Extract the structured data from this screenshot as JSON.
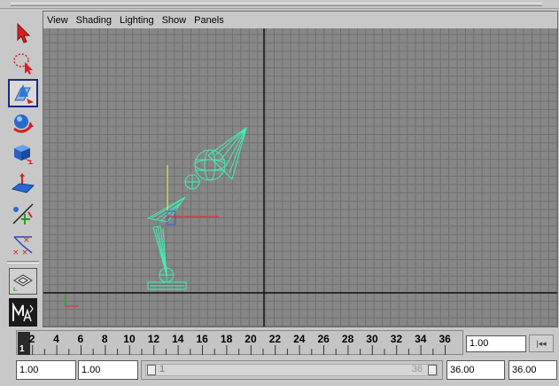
{
  "panel_menu": {
    "items": [
      "View",
      "Shading",
      "Lighting",
      "Show",
      "Panels"
    ]
  },
  "toolbox": {
    "tools": [
      {
        "name": "select-tool-icon"
      },
      {
        "name": "lasso-tool-icon"
      },
      {
        "name": "move-tool-icon",
        "active": true
      },
      {
        "name": "rotate-tool-icon"
      },
      {
        "name": "scale-tool-icon"
      },
      {
        "name": "soft-mod-tool-icon"
      },
      {
        "name": "show-manipulator-icon"
      },
      {
        "name": "ik-handle-icon"
      }
    ],
    "layout_button": "single-perspective-layout-icon",
    "logo": "maya-logo"
  },
  "time_slider": {
    "ticks": [
      "2",
      "4",
      "6",
      "8",
      "10",
      "12",
      "14",
      "16",
      "18",
      "20",
      "22",
      "24",
      "26",
      "28",
      "30",
      "32",
      "34",
      "36"
    ],
    "current_frame": "1",
    "current_time_field": "1.00",
    "play_icon": "step-back-to-start-icon"
  },
  "range_slider": {
    "start_time": "1.00",
    "playback_start": "1.00",
    "range_start_label": "1",
    "range_end_label": "36",
    "playback_end": "36.00",
    "end_time": "36.00"
  },
  "colors": {
    "viewport_bg": "#878787",
    "wireframe": "#3ff0b4",
    "axis_x": "#e03030",
    "axis_y": "#e8e840",
    "axis_z": "#3060e0"
  }
}
